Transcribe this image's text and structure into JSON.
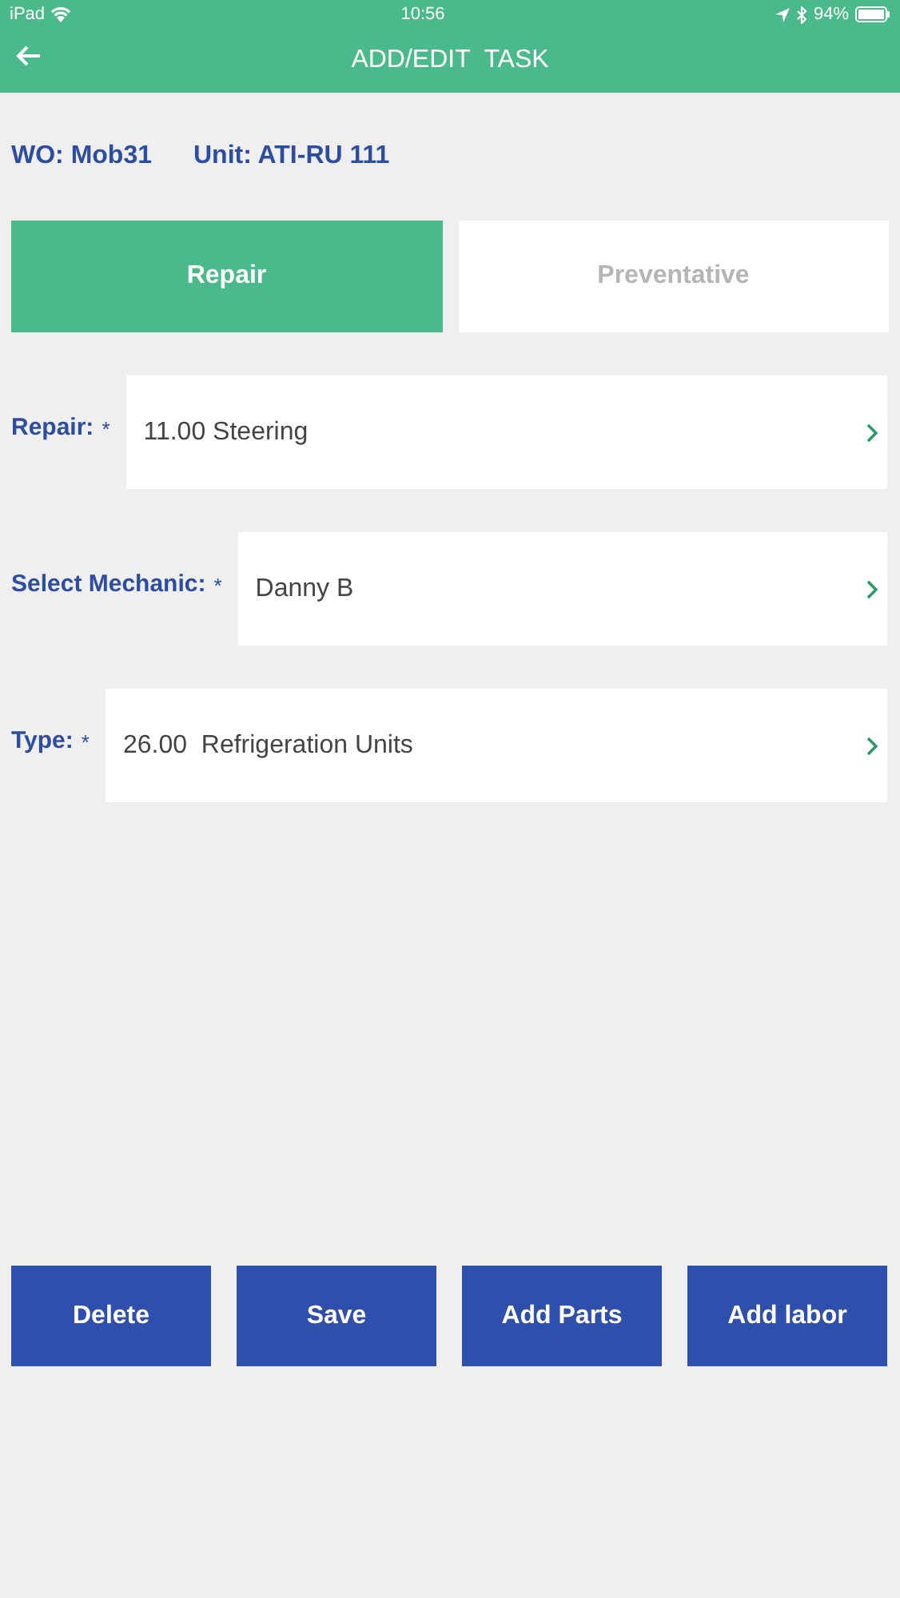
{
  "status_bar": {
    "device": "iPad",
    "time": "10:56",
    "battery": "94%"
  },
  "header": {
    "title": "ADD/EDIT  TASK"
  },
  "info": [
    {
      "text": "WO: Mob31"
    },
    {
      "text": "Unit: ATI-RU 111"
    }
  ],
  "tabs": [
    {
      "label": "Repair",
      "selected": true
    },
    {
      "label": "Preventative",
      "selected": false
    }
  ],
  "fields": [
    {
      "label": "Repair:",
      "mark": "*",
      "value": "11.00 Steering"
    },
    {
      "label": "Select Mechanic:",
      "mark": "*",
      "value": "Danny B"
    },
    {
      "label": "Type:",
      "mark": "*",
      "value": "26.00  Refrigeration Units"
    }
  ],
  "buttons": [
    "Delete",
    "Save",
    "Add Parts",
    "Add labor"
  ]
}
